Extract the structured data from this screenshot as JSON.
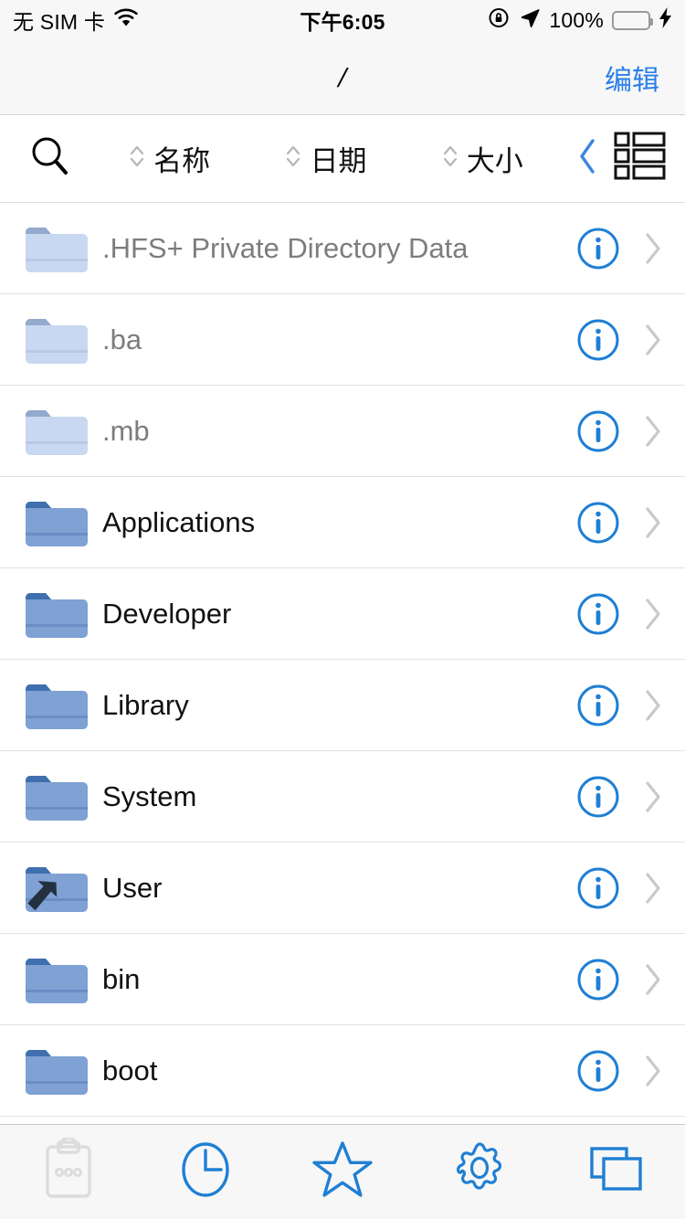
{
  "status_bar": {
    "carrier": "无 SIM 卡",
    "wifi_icon": "wifi-icon",
    "time": "下午6:05",
    "rotation_lock_icon": "rotation-lock-icon",
    "location_icon": "location-arrow-icon",
    "battery_percent": "100%",
    "battery_icon": "battery-icon",
    "charging_icon": "lightning-bolt-icon",
    "battery_color": "#4cd364"
  },
  "nav_bar": {
    "title": "/",
    "edit_label": "编辑",
    "accent_color": "#2a7fe8"
  },
  "toolbar": {
    "search_icon": "search-icon",
    "sort_options": [
      {
        "label": "名称",
        "icon": "sort-updown-icon"
      },
      {
        "label": "日期",
        "icon": "sort-updown-icon"
      },
      {
        "label": "大小",
        "icon": "sort-updown-icon"
      }
    ],
    "back_chevron_icon": "chevron-left-icon",
    "view_toggle_icon": "list-view-icon"
  },
  "file_list": {
    "info_icon": "info-circle-icon",
    "disclosure_icon": "chevron-right-icon",
    "folder_color": "#7fa1d3",
    "folder_tab_color": "#3f6fae",
    "folder_hidden_color": "#c8d8f0",
    "folder_hidden_tab_color": "#93a9cd",
    "items": [
      {
        "name": ".HFS+ Private Directory Data",
        "type": "folder",
        "hidden": true,
        "alias": false
      },
      {
        "name": ".ba",
        "type": "folder",
        "hidden": true,
        "alias": false
      },
      {
        "name": ".mb",
        "type": "folder",
        "hidden": true,
        "alias": false
      },
      {
        "name": "Applications",
        "type": "folder",
        "hidden": false,
        "alias": false
      },
      {
        "name": "Developer",
        "type": "folder",
        "hidden": false,
        "alias": false
      },
      {
        "name": "Library",
        "type": "folder",
        "hidden": false,
        "alias": false
      },
      {
        "name": "System",
        "type": "folder",
        "hidden": false,
        "alias": false
      },
      {
        "name": "User",
        "type": "folder",
        "hidden": false,
        "alias": true
      },
      {
        "name": "bin",
        "type": "folder",
        "hidden": false,
        "alias": false
      },
      {
        "name": "boot",
        "type": "folder",
        "hidden": false,
        "alias": false
      }
    ]
  },
  "tab_bar": {
    "active_color": "#1f7fd4",
    "disabled_color": "#dcdcdc",
    "tabs": [
      {
        "icon": "clipboard-icon",
        "enabled": false
      },
      {
        "icon": "clock-icon",
        "enabled": true
      },
      {
        "icon": "star-icon",
        "enabled": true
      },
      {
        "icon": "gear-icon",
        "enabled": true
      },
      {
        "icon": "windows-icon",
        "enabled": true
      }
    ]
  }
}
